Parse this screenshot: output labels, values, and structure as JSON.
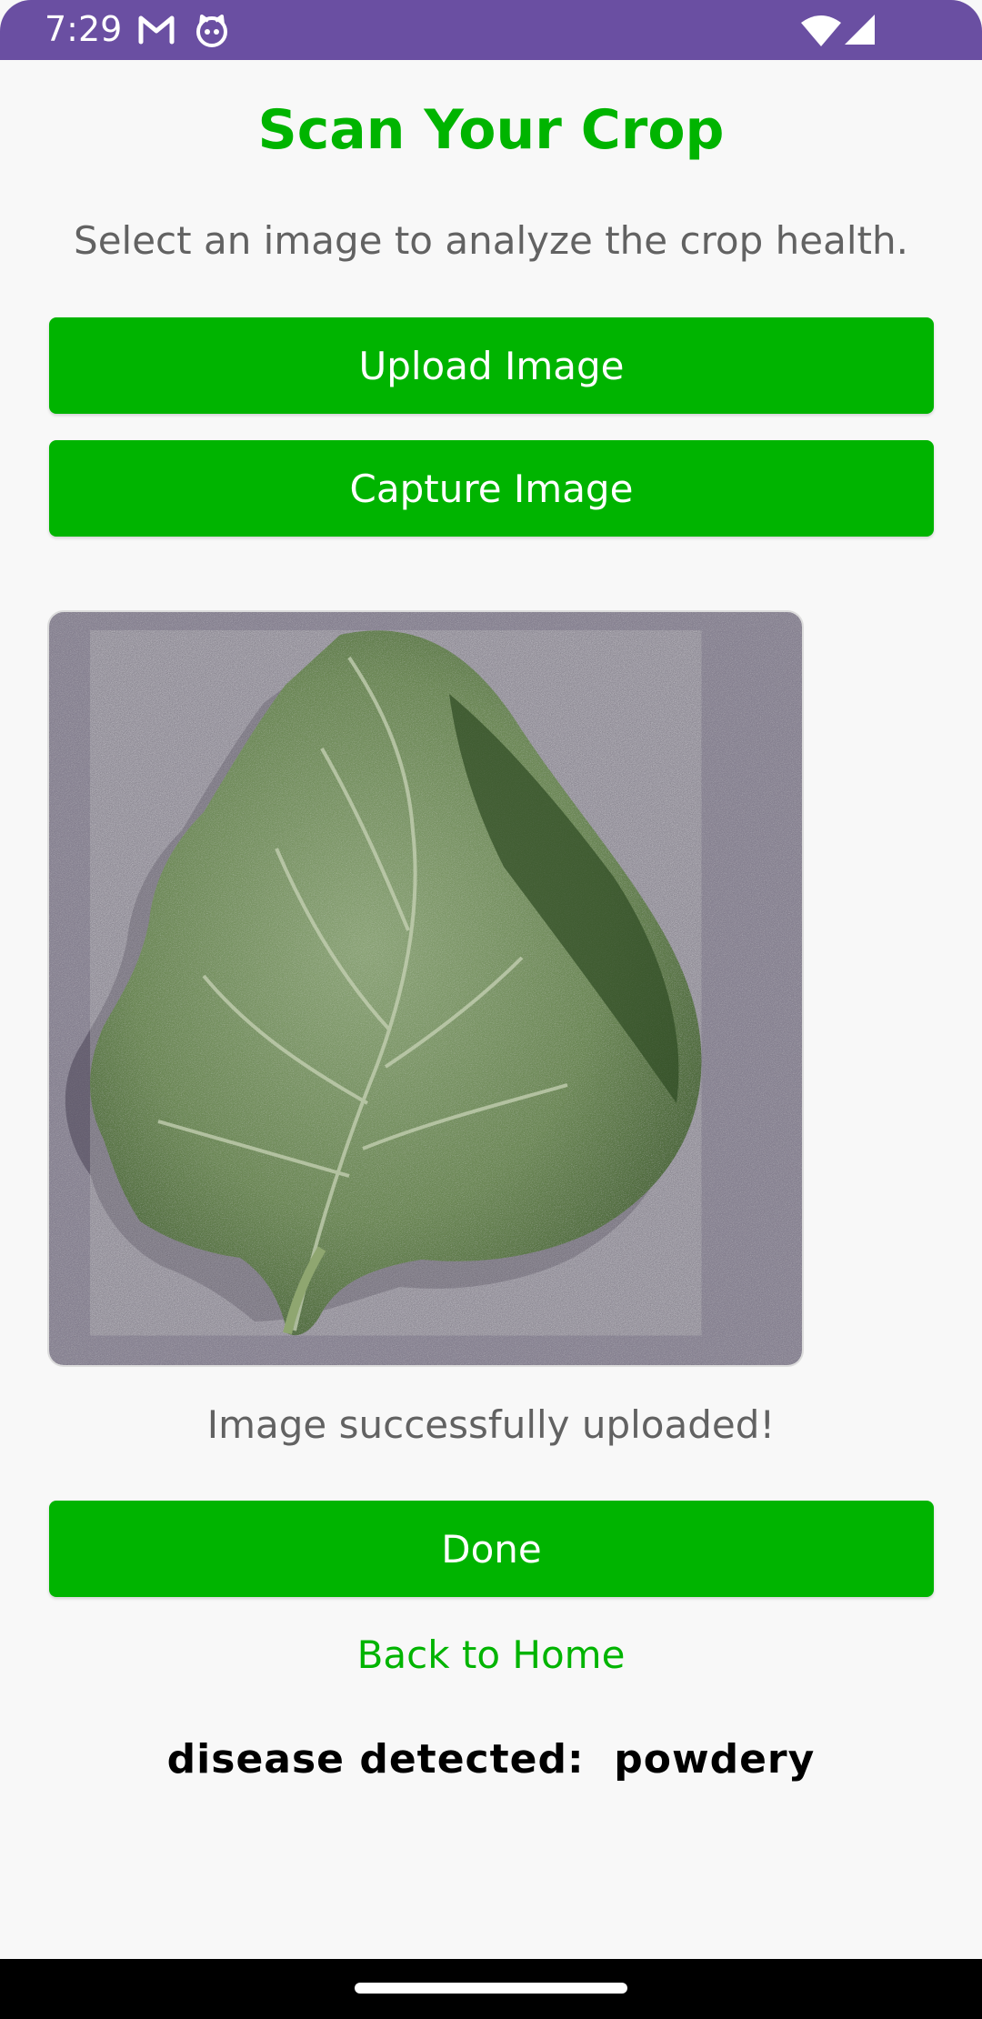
{
  "status_bar": {
    "time": "7:29",
    "icons": [
      "gmail-icon",
      "cat-face-icon",
      "wifi-icon",
      "signal-icon"
    ]
  },
  "page": {
    "title": "Scan Your Crop",
    "subtitle": "Select an image to analyze the crop health.",
    "upload_button_label": "Upload Image",
    "capture_button_label": "Capture Image",
    "preview_image": "green leaf with powdery mildew",
    "upload_status": "Image successfully uploaded!",
    "done_button_label": "Done",
    "back_link_label": "Back to Home",
    "result_text": "disease detected:  powdery"
  },
  "colors": {
    "status_bar": "#6a4fa2",
    "accent": "#00b400",
    "background": "#f8f8f8",
    "muted_text": "#626262"
  }
}
